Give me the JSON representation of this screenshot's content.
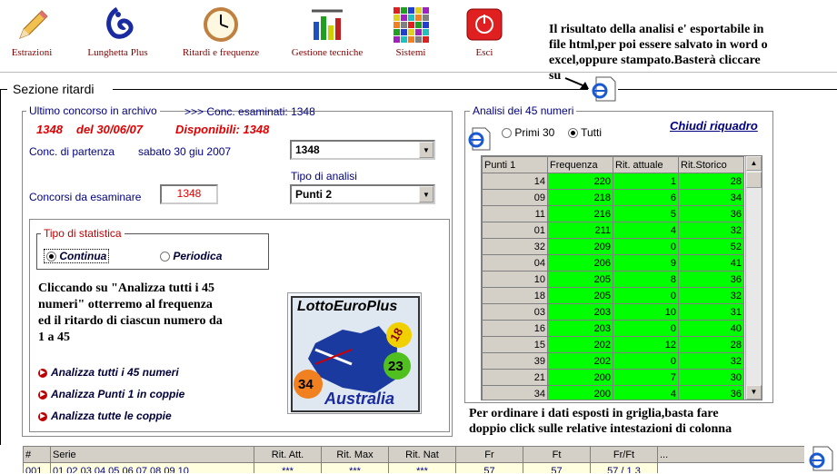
{
  "toolbar": [
    {
      "label": "Estrazioni",
      "icon": "pencil-icon"
    },
    {
      "label": "Lunghetta Plus",
      "icon": "lottery-hand-icon"
    },
    {
      "label": "Ritardi e frequenze",
      "icon": "clock-icon"
    },
    {
      "label": "Gestione tecniche",
      "icon": "tools-icon"
    },
    {
      "label": "Sistemi",
      "icon": "grid-icon"
    },
    {
      "label": "Esci",
      "icon": "exit-icon"
    }
  ],
  "note_top": [
    "Il risultato della analisi e' esportabile in",
    "file html,per poi essere salvato in word o",
    "excel,oppure stampato.Basterà cliccare",
    "su"
  ],
  "section_title": "Sezione ritardi",
  "archive": {
    "group_title": "Ultimo concorso in archivo",
    "examined": ">>> Conc. esaminati: 1348",
    "last_num": "1348",
    "last_date": "del 30/06/07",
    "available": "Disponibili: 1348"
  },
  "start": {
    "label": "Conc. di partenza",
    "date": "sabato 30 giu 2007",
    "select": "1348"
  },
  "analysis_type": {
    "label": "Tipo di analisi",
    "select": "Punti 2"
  },
  "to_examine": {
    "label": "Concorsi da esaminare",
    "value": "1348"
  },
  "stat": {
    "title": "Tipo di statistica",
    "opt1": "Continua",
    "opt2": "Periodica"
  },
  "help_text": [
    "Cliccando su \"Analizza tutti i 45",
    "numeri\" otterremo al frequenza",
    "ed il ritardo di ciascun numero da",
    "1 a 45"
  ],
  "logo": {
    "title": "LottoEuroPlus",
    "country": "Australia",
    "balls": [
      "18",
      "23",
      "34"
    ]
  },
  "actions": [
    "Analizza tutti i 45 numeri",
    "Analizza Punti 1 in coppie",
    "Analizza tutte le coppie"
  ],
  "right": {
    "group_title": "Analisi dei 45 numeri",
    "opt1": "Primi 30",
    "opt2": "Tutti",
    "close": "Chiudi riquadro",
    "columns": [
      "Punti 1",
      "Frequenza",
      "Rit. attuale",
      "Rit.Storico"
    ],
    "rows": [
      [
        "14",
        "220",
        "1",
        "28"
      ],
      [
        "09",
        "218",
        "6",
        "34"
      ],
      [
        "11",
        "216",
        "5",
        "36"
      ],
      [
        "01",
        "211",
        "4",
        "32"
      ],
      [
        "32",
        "209",
        "0",
        "52"
      ],
      [
        "04",
        "206",
        "9",
        "41"
      ],
      [
        "10",
        "205",
        "8",
        "36"
      ],
      [
        "18",
        "205",
        "0",
        "32"
      ],
      [
        "03",
        "203",
        "10",
        "31"
      ],
      [
        "16",
        "203",
        "0",
        "40"
      ],
      [
        "15",
        "202",
        "12",
        "28"
      ],
      [
        "39",
        "202",
        "0",
        "32"
      ],
      [
        "21",
        "200",
        "7",
        "30"
      ],
      [
        "34",
        "200",
        "4",
        "36"
      ]
    ]
  },
  "note_bottom": [
    "Per ordinare i dati esposti in griglia,basta fare",
    "doppio click sulle relative intestazioni di colonna"
  ],
  "bottom": {
    "columns": [
      "#",
      "Serie",
      "Rit. Att.",
      "Rit. Max",
      "Rit. Nat",
      "Fr",
      "Ft",
      "Fr/Ft",
      "..."
    ],
    "row": [
      "001",
      "01 02 03 04 05 06 07 08 09 10",
      "***",
      "***",
      "***",
      "57",
      "57",
      "57 / 1 3"
    ]
  }
}
